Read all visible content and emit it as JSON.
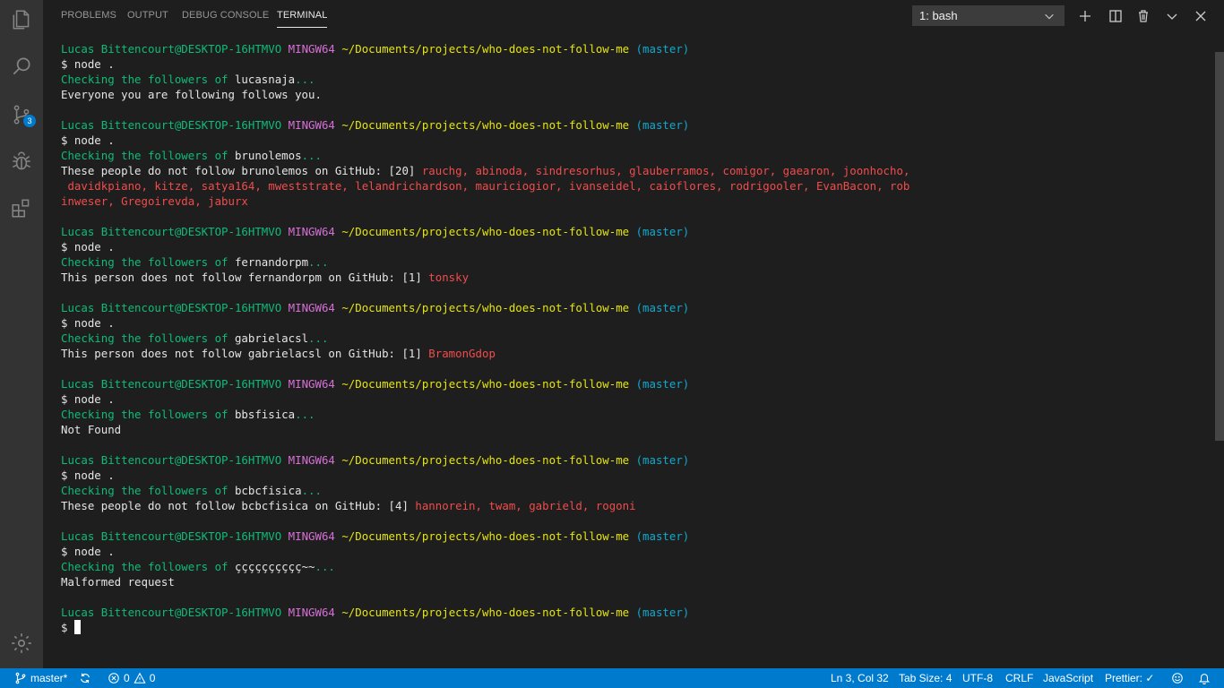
{
  "panel": {
    "tabs": [
      "PROBLEMS",
      "OUTPUT",
      "DEBUG CONSOLE",
      "TERMINAL"
    ],
    "active_tab": "TERMINAL",
    "terminal_select": "1: bash"
  },
  "activity_bar": {
    "items": [
      "explorer-icon",
      "search-icon",
      "source-control-icon",
      "debug-icon",
      "extensions-icon"
    ],
    "scm_badge": "3",
    "bottom": "settings-gear-icon"
  },
  "terminal": {
    "prompt": {
      "user": "Lucas Bittencourt@DESKTOP-16HTMVO",
      "shell": "MINGW64",
      "path": "~/Documents/projects/who-does-not-follow-me",
      "branch": "(master)"
    },
    "cmd": "$ node .",
    "checking_prefix": "Checking the followers of",
    "ellipsis": "...",
    "runs": [
      {
        "user": "lucasnaja",
        "result": "Everyone you are following follows you."
      },
      {
        "user": "brunolemos",
        "result_prefix": "These people do not follow brunolemos on GitHub: [20]",
        "lines": [
          " rauchg, abinoda, sindresorhus, glauberramos, comigor, gaearon, joonhocho,",
          " davidkpiano, kitze, satya164, mweststrate, lelandrichardson, mauriciogior, ivanseidel, caioflores, rodrigooler, EvanBacon, rob",
          "inweser, Gregoirevda, jaburx"
        ]
      },
      {
        "user": "fernandorpm",
        "result_prefix": "This person does not follow fernandorpm on GitHub: [1]",
        "names": " tonsky"
      },
      {
        "user": "gabrielacsl",
        "result_prefix": "This person does not follow gabrielacsl on GitHub: [1]",
        "names": " BramonGdop"
      },
      {
        "user": "bbsfisica",
        "result": "Not Found"
      },
      {
        "user": "bcbcfisica",
        "result_prefix": "These people do not follow bcbcfisica on GitHub: [4]",
        "names": " hannorein, twam, gabrield, rogoni"
      },
      {
        "user": "çççççççççç~~",
        "result": "Malformed request"
      }
    ],
    "final_prompt": "$ "
  },
  "status_bar": {
    "branch": "master*",
    "errors": "0",
    "warnings": "0",
    "position": "Ln 3, Col 32",
    "tab_size": "Tab Size: 4",
    "encoding": "UTF-8",
    "eol": "CRLF",
    "language": "JavaScript",
    "prettier": "Prettier: ✓"
  }
}
